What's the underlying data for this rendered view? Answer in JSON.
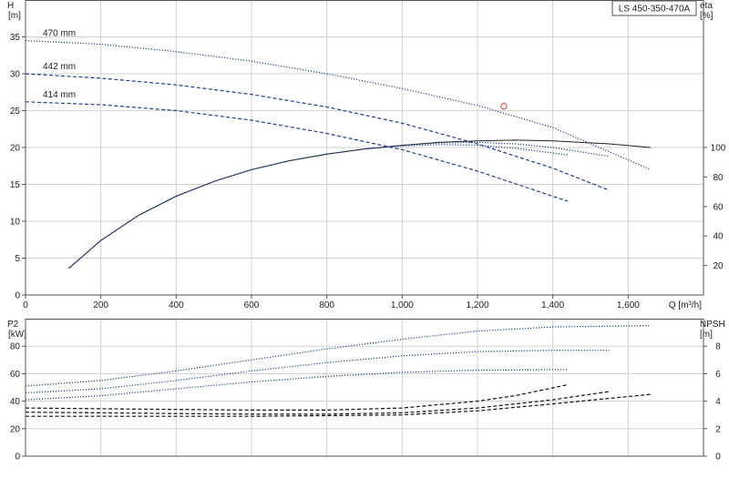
{
  "model_label": "LS 450-350-470A",
  "colors": {
    "head": "#1f3f8f",
    "efficiency": "#1f3f8f",
    "efficiency_overlay": "#222222",
    "power": "#1f3f8f",
    "npsh": "#111111",
    "marker": "#e04040",
    "grid": "#d0d0d0"
  },
  "chart_data": [
    {
      "type": "line",
      "title": "",
      "x_axis": {
        "label": "Q [m³/h]",
        "range": [
          0,
          1800
        ],
        "ticks": [
          0,
          200,
          400,
          600,
          800,
          1000,
          1200,
          1400,
          1600
        ],
        "tick_labels": [
          "0",
          "200",
          "400",
          "600",
          "800",
          "1,000",
          "1,200",
          "1,400",
          "1,600"
        ]
      },
      "y_axis_left": {
        "label": "H",
        "unit": "[m]",
        "range": [
          0,
          40
        ],
        "ticks": [
          0,
          5,
          10,
          15,
          20,
          25,
          30,
          35
        ]
      },
      "y_axis_right": {
        "label": "eta",
        "unit": "[%]",
        "range": [
          0,
          200
        ],
        "ticks": [
          20,
          40,
          60,
          80,
          100
        ]
      },
      "grid": true,
      "series": [
        {
          "name": "470 mm",
          "axis": "left",
          "style": "dotted",
          "x": [
            0,
            200,
            400,
            600,
            800,
            1000,
            1200,
            1400,
            1660
          ],
          "y": [
            34.5,
            34.0,
            33.0,
            31.7,
            30.0,
            28.0,
            25.7,
            22.7,
            17.0
          ]
        },
        {
          "name": "442 mm",
          "axis": "left",
          "style": "dashed",
          "x": [
            0,
            200,
            400,
            600,
            800,
            1000,
            1200,
            1400,
            1550
          ],
          "y": [
            30.0,
            29.4,
            28.5,
            27.2,
            25.5,
            23.3,
            20.5,
            17.2,
            14.2
          ]
        },
        {
          "name": "414 mm",
          "axis": "left",
          "style": "dashed",
          "x": [
            0,
            200,
            400,
            600,
            800,
            1000,
            1200,
            1440
          ],
          "y": [
            26.2,
            25.8,
            25.0,
            23.7,
            21.9,
            19.7,
            16.8,
            12.7
          ]
        },
        {
          "name": "",
          "axis": "right",
          "style": "solid",
          "x": [
            115,
            200,
            300,
            400,
            500,
            600,
            700,
            800,
            900,
            1000,
            1100,
            1200,
            1300,
            1400,
            1550,
            1660
          ],
          "y": [
            18,
            37,
            54,
            67,
            77,
            85,
            91,
            95.5,
            99,
            101.5,
            103.5,
            104.5,
            105,
            104.5,
            102.5,
            100
          ]
        },
        {
          "name": "",
          "axis": "right",
          "style": "dotted",
          "x": [
            115,
            200,
            300,
            400,
            500,
            600,
            700,
            800,
            900,
            1000,
            1100,
            1200,
            1300,
            1400,
            1550
          ],
          "y": [
            18,
            37,
            54,
            67,
            77,
            85,
            91,
            95.5,
            99,
            101.5,
            103,
            103.5,
            102.5,
            100,
            94
          ]
        },
        {
          "name": "",
          "axis": "right",
          "style": "dotted",
          "x": [
            115,
            200,
            300,
            400,
            500,
            600,
            700,
            800,
            900,
            1000,
            1100,
            1200,
            1300,
            1440
          ],
          "y": [
            18,
            37,
            54,
            67,
            77,
            85,
            91,
            95.5,
            99,
            101,
            102,
            101.5,
            99.5,
            95
          ]
        }
      ],
      "point": {
        "x": 1270,
        "y": 25.6
      }
    },
    {
      "type": "line",
      "title": "",
      "x_axis": {
        "range": [
          0,
          1800
        ]
      },
      "y_axis_left": {
        "label": "P2",
        "unit": "[kW]",
        "range": [
          0,
          100
        ],
        "ticks": [
          0,
          20,
          40,
          60,
          80
        ]
      },
      "y_axis_right": {
        "label": "NPSH",
        "unit": "[m]",
        "range": [
          0,
          10
        ],
        "ticks": [
          0,
          2,
          4,
          6,
          8
        ]
      },
      "grid": true,
      "series": [
        {
          "name": "",
          "axis": "left",
          "style": "dotted",
          "x": [
            0,
            200,
            400,
            600,
            800,
            1000,
            1200,
            1400,
            1660
          ],
          "y": [
            51,
            55,
            62,
            70,
            78,
            85,
            91,
            94,
            95
          ]
        },
        {
          "name": "",
          "axis": "left",
          "style": "dotted",
          "x": [
            0,
            200,
            400,
            600,
            800,
            1000,
            1200,
            1400,
            1550
          ],
          "y": [
            46,
            49,
            55,
            62,
            68,
            73,
            76,
            77,
            77
          ]
        },
        {
          "name": "",
          "axis": "left",
          "style": "dotted",
          "x": [
            0,
            200,
            400,
            600,
            800,
            1000,
            1200,
            1440
          ],
          "y": [
            41,
            44,
            49,
            54,
            58,
            61,
            62.5,
            63
          ]
        },
        {
          "name": "",
          "axis": "right",
          "style": "dashed",
          "x": [
            0,
            200,
            400,
            600,
            800,
            1000,
            1200,
            1300,
            1440
          ],
          "y": [
            3.5,
            3.45,
            3.4,
            3.35,
            3.35,
            3.5,
            4.0,
            4.4,
            5.2
          ]
        },
        {
          "name": "",
          "axis": "right",
          "style": "dashed",
          "x": [
            0,
            200,
            400,
            600,
            800,
            1000,
            1200,
            1400,
            1550
          ],
          "y": [
            3.2,
            3.15,
            3.1,
            3.05,
            3.05,
            3.15,
            3.5,
            4.1,
            4.7
          ]
        },
        {
          "name": "",
          "axis": "right",
          "style": "dashed",
          "x": [
            0,
            200,
            400,
            600,
            800,
            1000,
            1200,
            1400,
            1660
          ],
          "y": [
            2.9,
            2.9,
            2.9,
            2.9,
            2.95,
            3.0,
            3.3,
            3.8,
            4.5
          ]
        }
      ]
    }
  ]
}
